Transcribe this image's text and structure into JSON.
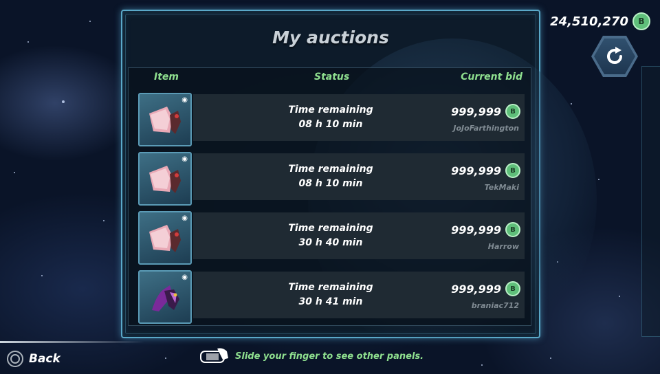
{
  "header": {
    "title": "My auctions",
    "balance": "24,510,270"
  },
  "columns": {
    "item": "Item",
    "status": "Status",
    "current_bid": "Current bid"
  },
  "auctions": [
    {
      "item_icon": "pink-mech-icon",
      "status_label": "Time remaining",
      "time": "08 h 10 min",
      "bid": "999,999",
      "bidder": "JoJoFarthington"
    },
    {
      "item_icon": "pink-mech-icon",
      "status_label": "Time remaining",
      "time": "08 h 10 min",
      "bid": "999,999",
      "bidder": "TekMaki"
    },
    {
      "item_icon": "pink-mech-icon",
      "status_label": "Time remaining",
      "time": "30 h 40 min",
      "bid": "999,999",
      "bidder": "Harrow"
    },
    {
      "item_icon": "purple-mech-icon",
      "status_label": "Time remaining",
      "time": "30 h 41 min",
      "bid": "999,999",
      "bidder": "braniac712"
    }
  ],
  "footer": {
    "back_label": "Back",
    "hint": "Slide your finger to see other panels."
  },
  "colors": {
    "accent_green": "#8fe08f",
    "panel_border": "#5aa9c9",
    "coin": "#5fbf7a"
  }
}
